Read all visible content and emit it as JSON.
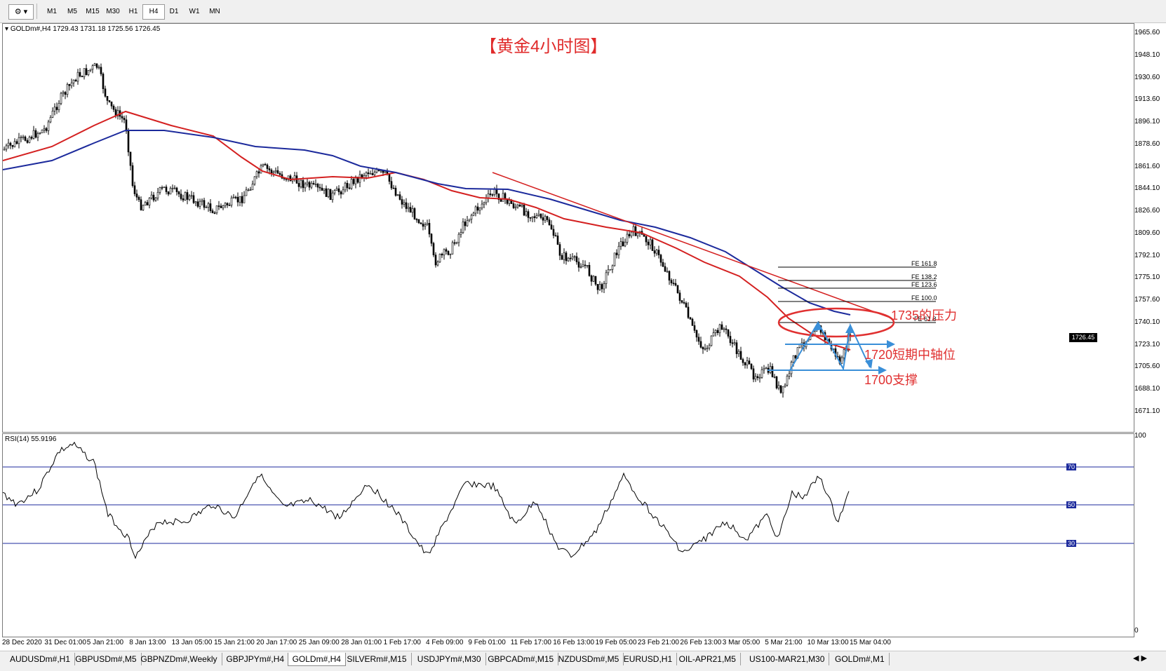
{
  "toolbar": {
    "tool_icon": "drawing-tools-icon",
    "timeframes": [
      "M1",
      "M5",
      "M15",
      "M30",
      "H1",
      "H4",
      "D1",
      "W1",
      "MN"
    ],
    "active_timeframe": "H4"
  },
  "chart": {
    "info": "GOLDm#,H4  1729.43 1731.18 1725.56 1726.45",
    "title": "【黄金4小时图】",
    "price_tag": "1726.45",
    "y_ticks": [
      "1965.60",
      "1948.10",
      "1930.60",
      "1913.60",
      "1896.10",
      "1878.60",
      "1861.60",
      "1844.10",
      "1826.60",
      "1809.60",
      "1792.10",
      "1775.10",
      "1757.60",
      "1740.10",
      "1723.10",
      "1705.60",
      "1688.10",
      "1671.10"
    ],
    "fe_levels": [
      "FE 161.8",
      "FE 138.2",
      "FE 123.6",
      "FE 100.0",
      "FE 61.8"
    ],
    "annotations": {
      "resistance": "1735的压力",
      "pivot": "1720短期中轴位",
      "support": "1700支撑"
    }
  },
  "rsi": {
    "info": "RSI(14) 55.9196",
    "levels": [
      "100",
      "70",
      "50",
      "30",
      "0"
    ]
  },
  "x_axis": [
    "28 Dec 2020",
    "31 Dec 01:00",
    "5 Jan 21:00",
    "8 Jan 13:00",
    "13 Jan 05:00",
    "15 Jan 21:00",
    "20 Jan 17:00",
    "25 Jan 09:00",
    "28 Jan 01:00",
    "1 Feb 17:00",
    "4 Feb 09:00",
    "9 Feb 01:00",
    "11 Feb 17:00",
    "16 Feb 13:00",
    "19 Feb 05:00",
    "23 Feb 21:00",
    "26 Feb 13:00",
    "3 Mar 05:00",
    "5 Mar 21:00",
    "10 Mar 13:00",
    "15 Mar 04:00"
  ],
  "tabs": [
    "AUDUSDm#,H1",
    "GBPUSDm#,M5",
    "GBPNZDm#,Weekly",
    "GBPJPYm#,H4",
    "GOLDm#,H4",
    "SILVERm#,M15",
    "USDJPYm#,M30",
    "GBPCADm#,M15",
    "NZDUSDm#,M5",
    "EURUSD,H1",
    "OIL-APR21,M5",
    "US100-MAR21,M30",
    "GOLDm#,M1"
  ],
  "active_tab": "GOLDm#,H4",
  "scroll_icon": "tab-scroll-arrows-icon"
}
